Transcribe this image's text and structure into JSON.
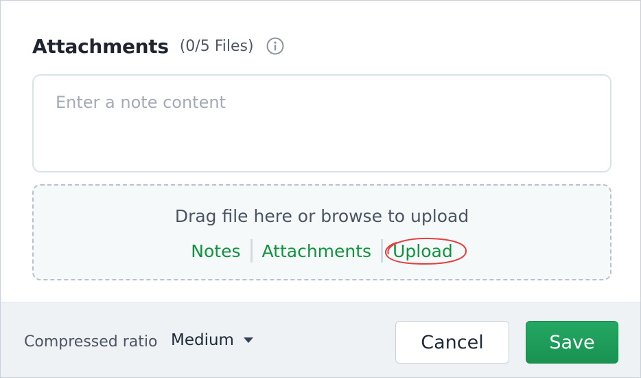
{
  "header": {
    "title": "Attachments",
    "count": "(0/5 Files)",
    "info_icon": "info-circle-icon"
  },
  "note": {
    "placeholder": "Enter a note content",
    "value": ""
  },
  "dropzone": {
    "text": "Drag file here or browse to upload",
    "links": [
      "Notes",
      "Attachments",
      "Upload"
    ],
    "highlighted_link": "Upload",
    "highlight_color": "#e53e3e"
  },
  "footer": {
    "ratio_label": "Compressed ratio",
    "ratio_value": "Medium",
    "cancel_label": "Cancel",
    "save_label": "Save"
  },
  "colors": {
    "link": "#12923f",
    "save_button": "#1f9d5b",
    "footer_bg": "#eef2f5",
    "dropzone_bg": "#f6f9fa"
  }
}
